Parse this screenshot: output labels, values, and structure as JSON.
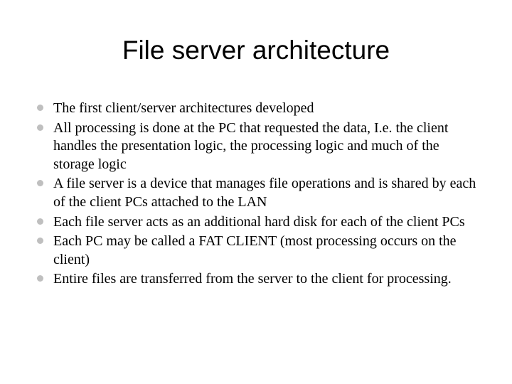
{
  "slide": {
    "title": "File server architecture",
    "bullets": [
      "The first client/server architectures developed",
      "All processing is done at the PC that requested the data, I.e. the client handles the presentation logic, the processing logic and much of the storage logic",
      "A file server is a device that manages file operations and is shared by each of the client PCs attached to the LAN",
      "Each file server acts as an additional hard disk for each of the client PCs",
      "Each PC may be called a FAT CLIENT (most processing occurs on the client)",
      "Entire files are transferred from the server to the client for processing."
    ]
  }
}
